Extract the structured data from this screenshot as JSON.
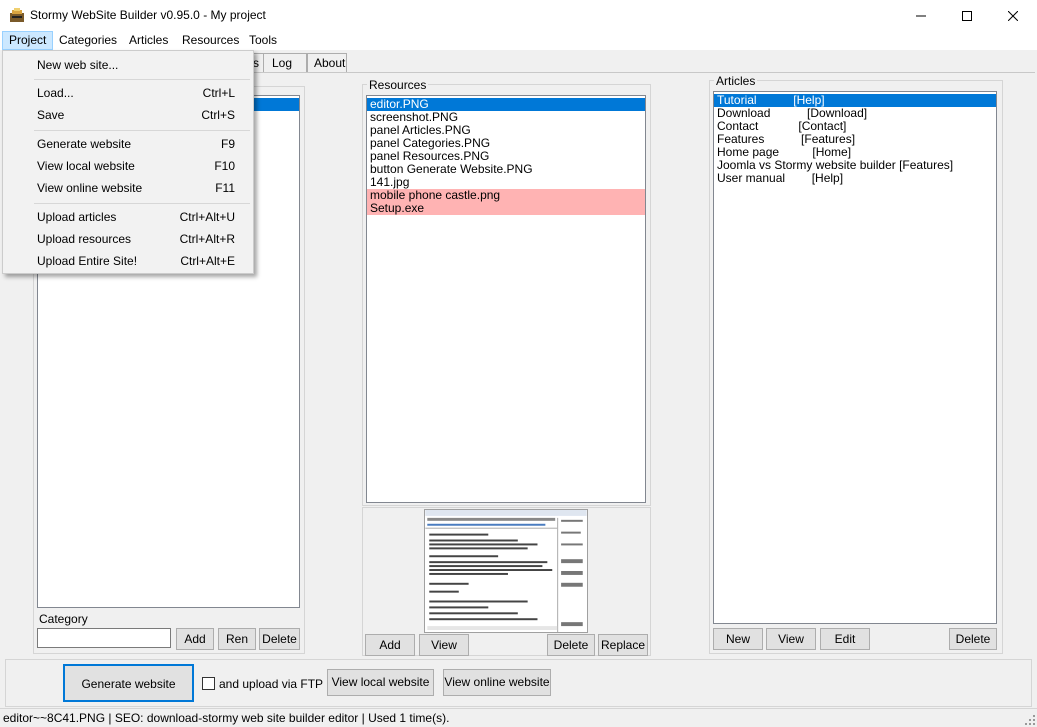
{
  "window": {
    "title": "Stormy WebSite Builder  v0.95.0 - My project"
  },
  "menubar": {
    "items": [
      "Project",
      "Categories",
      "Articles",
      "Resources",
      "Tools"
    ]
  },
  "tabs": [
    "s",
    "Log",
    "About"
  ],
  "project_menu": {
    "items": [
      {
        "label": "New web site...",
        "shortcut": ""
      },
      {
        "label": "Load...",
        "shortcut": "Ctrl+L"
      },
      {
        "label": "Save",
        "shortcut": "Ctrl+S"
      },
      {
        "label": "Generate website",
        "shortcut": "F9"
      },
      {
        "label": "View local website",
        "shortcut": "F10"
      },
      {
        "label": "View online website",
        "shortcut": "F11"
      },
      {
        "label": "Upload articles",
        "shortcut": "Ctrl+Alt+U"
      },
      {
        "label": "Upload resources",
        "shortcut": "Ctrl+Alt+R"
      },
      {
        "label": "Upload Entire Site!",
        "shortcut": "Ctrl+Alt+E"
      }
    ]
  },
  "categories_panel": {
    "category_label": "Category",
    "category_value": "",
    "add_label": "Add",
    "rename_label": "Ren",
    "delete_label": "Delete"
  },
  "resources_panel": {
    "title": "Resources",
    "items": [
      {
        "name": "editor.PNG",
        "state": "selected"
      },
      {
        "name": "screenshot.PNG",
        "state": "normal"
      },
      {
        "name": "panel Articles.PNG",
        "state": "normal"
      },
      {
        "name": "panel Categories.PNG",
        "state": "normal"
      },
      {
        "name": "panel Resources.PNG",
        "state": "normal"
      },
      {
        "name": "button Generate Website.PNG",
        "state": "normal"
      },
      {
        "name": "141.jpg",
        "state": "normal"
      },
      {
        "name": "mobile phone castle.png",
        "state": "unused"
      },
      {
        "name": "Setup.exe",
        "state": "unused"
      }
    ],
    "add_label": "Add",
    "view_label": "View",
    "delete_label": "Delete",
    "replace_label": "Replace"
  },
  "articles_panel": {
    "title": "Articles",
    "items": [
      {
        "text": "Tutorial           [Help]",
        "state": "selected"
      },
      {
        "text": "Download           [Download]",
        "state": "normal"
      },
      {
        "text": "Contact            [Contact]",
        "state": "normal"
      },
      {
        "text": "Features           [Features]",
        "state": "normal"
      },
      {
        "text": "Home page          [Home]",
        "state": "normal"
      },
      {
        "text": "Joomla vs Stormy website builder [Features]",
        "state": "normal"
      },
      {
        "text": "User manual        [Help]",
        "state": "normal"
      }
    ],
    "new_label": "New",
    "view_label": "View",
    "edit_label": "Edit",
    "delete_label": "Delete"
  },
  "bottom_bar": {
    "generate_label": "Generate website",
    "ftp_label": "and upload via FTP",
    "ftp_checked": false,
    "view_local_label": "View local website",
    "view_online_label": "View online website"
  },
  "status": {
    "text": "editor~~8C41.PNG | SEO: download-stormy web site builder editor | Used 1 time(s)."
  },
  "colors": {
    "selection": "#0078d7",
    "unused_resource": "#ffb3b3",
    "menu_highlight": "#cce8ff"
  }
}
